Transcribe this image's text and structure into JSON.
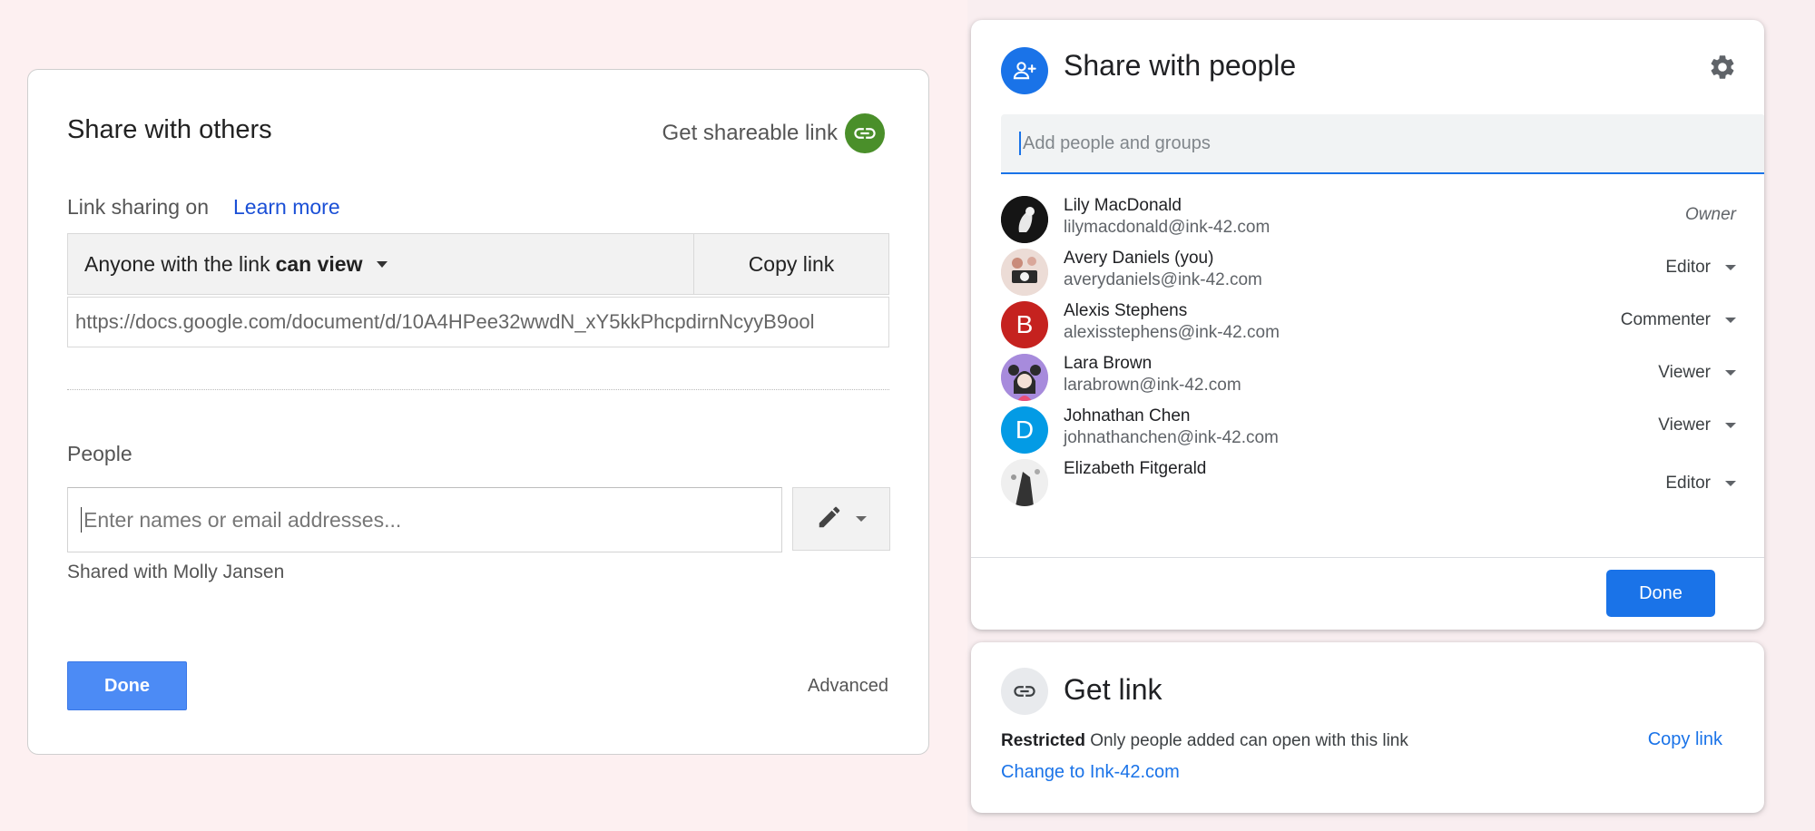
{
  "old_dialog": {
    "title": "Share with others",
    "get_shareable_link": "Get shareable link",
    "link_sharing_status": "Link sharing on",
    "learn_more": "Learn more",
    "access_prefix": "Anyone with the link",
    "access_level": "can view",
    "copy_link": "Copy link",
    "url": "https://docs.google.com/document/d/10A4HPee32wwdN_xY5kkPhcpdirnNcyyB9ool",
    "people_label": "People",
    "people_placeholder": "Enter names or email addresses...",
    "shared_with": "Shared with Molly Jansen",
    "done": "Done",
    "advanced": "Advanced"
  },
  "share_dialog": {
    "title": "Share with people",
    "header_icon": "person-add-icon",
    "settings_icon": "gear-icon",
    "add_placeholder": "Add people and groups",
    "people": [
      {
        "name": "Lily MacDonald",
        "email": "lilymacdonald@ink-42.com",
        "role": "Owner",
        "avatar": "photo"
      },
      {
        "name": "Avery Daniels (you)",
        "email": "averydaniels@ink-42.com",
        "role": "Editor",
        "avatar": "photo"
      },
      {
        "name": "Alexis Stephens",
        "email": "alexisstephens@ink-42.com",
        "role": "Commenter",
        "avatar_letter": "B",
        "avatar_color": "#c5221f"
      },
      {
        "name": "Lara Brown",
        "email": "larabrown@ink-42.com",
        "role": "Viewer",
        "avatar": "illustration"
      },
      {
        "name": "Johnathan Chen",
        "email": "johnathanchen@ink-42.com",
        "role": "Viewer",
        "avatar_letter": "D",
        "avatar_color": "#039be5"
      },
      {
        "name": "Elizabeth Fitgerald",
        "email": "",
        "role": "Editor",
        "avatar": "photo"
      }
    ],
    "done": "Done"
  },
  "get_link": {
    "title": "Get link",
    "icon": "link-icon",
    "restriction": "Restricted",
    "restriction_desc": "Only people added can open with this link",
    "copy_link": "Copy link",
    "change_link": "Change to Ink-42.com"
  },
  "colors": {
    "accent_blue": "#1a73e8",
    "old_done_blue": "#4c8bf5",
    "green_link": "#4a8f2a",
    "background": "#fdf0f1"
  }
}
